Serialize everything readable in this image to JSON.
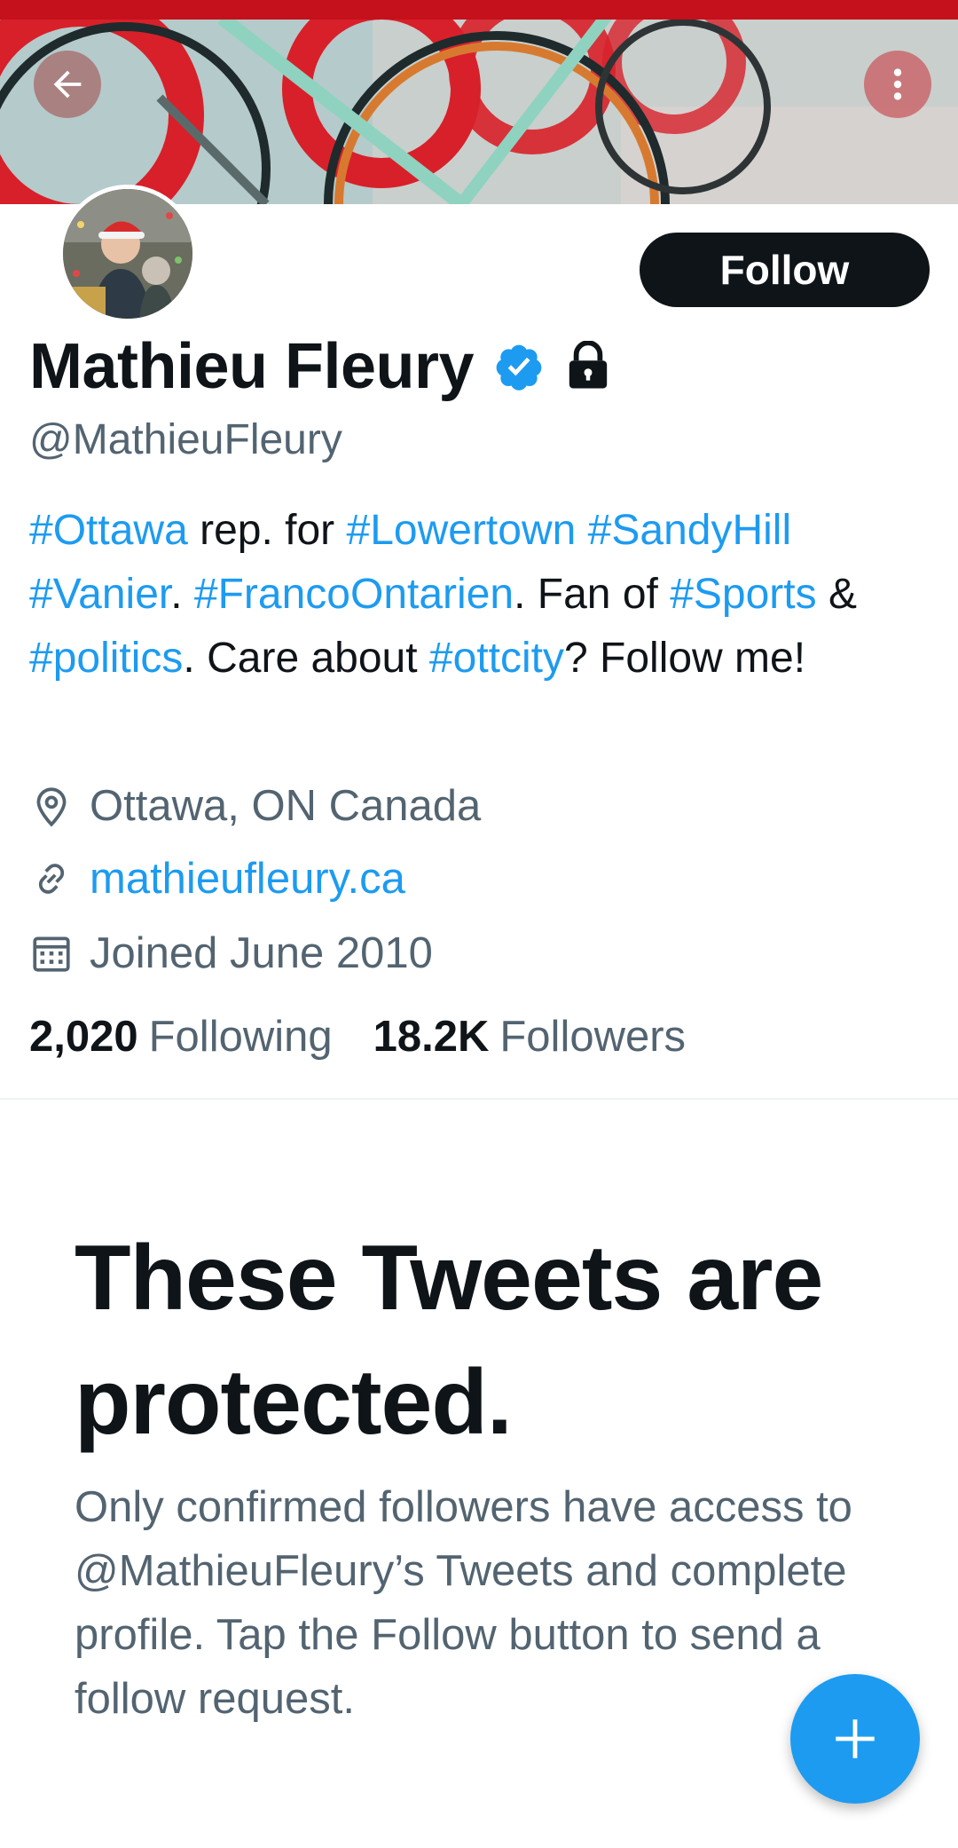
{
  "profile": {
    "display_name": "Mathieu Fleury",
    "handle": "@MathieuFleury",
    "follow_label": "Follow",
    "bio": {
      "t1": "#Ottawa",
      "t2": " rep. for ",
      "t3": "#Lowertown",
      "t4": " ",
      "t5": "#SandyHill",
      "t6": " ",
      "t7": "#Vanier",
      "t8": ". ",
      "t9": "#FrancoOntarien",
      "t10": ". Fan of ",
      "t11": "#Sports",
      "t12": " & ",
      "t13": "#politics",
      "t14": ". Care about ",
      "t15": "#ottcity",
      "t16": "? Follow me!"
    },
    "location": "Ottawa, ON Canada",
    "website": "mathieufleury.ca",
    "joined": "Joined June 2010",
    "following_count": "2,020",
    "following_label": "Following",
    "followers_count": "18.2K",
    "followers_label": "Followers"
  },
  "protected": {
    "title": "These Tweets are protected.",
    "body": "Only confirmed followers have access to @MathieuFleury’s Tweets and complete profile. Tap the Follow button to send a follow request."
  },
  "icons": {
    "back": "arrow-left-icon",
    "more": "more-vertical-icon",
    "verified": "verified-badge-icon",
    "lock": "lock-icon",
    "location": "location-pin-icon",
    "link": "link-icon",
    "calendar": "calendar-icon",
    "compose": "plus-icon"
  },
  "colors": {
    "accent": "#1d9bf0",
    "text": "#0f1419",
    "muted": "#536471",
    "statusbar": "#c4111c"
  }
}
